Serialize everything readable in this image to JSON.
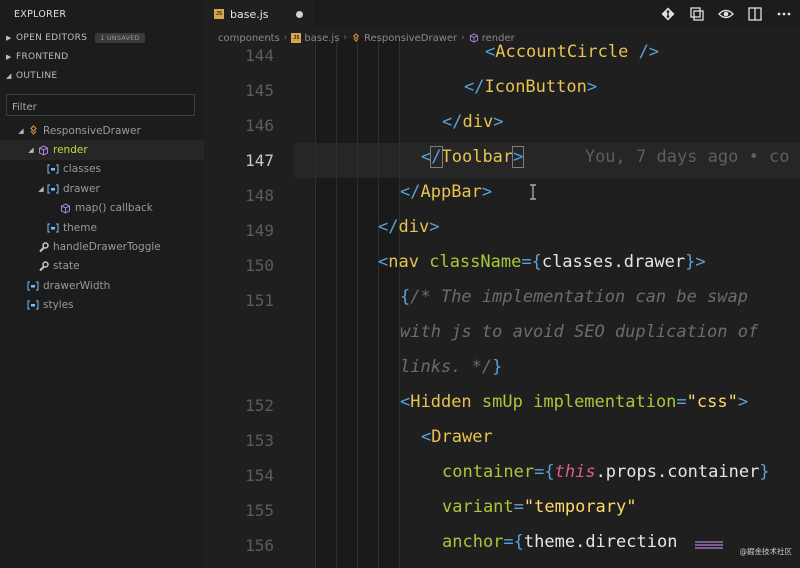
{
  "sidebar": {
    "title": "EXPLORER",
    "open_editors": {
      "label": "OPEN EDITORS",
      "badge": "1 UNSAVED"
    },
    "frontend": {
      "label": "FRONTEND"
    },
    "outline": {
      "label": "OUTLINE"
    },
    "filter": {
      "placeholder": "Filter"
    },
    "tree": [
      {
        "label": "ResponsiveDrawer",
        "icon": "component-icon",
        "depth": 2
      },
      {
        "label": "render",
        "icon": "method-cube-icon",
        "depth": 3,
        "selected": true
      },
      {
        "label": "classes",
        "icon": "variable-icon",
        "depth": 4
      },
      {
        "label": "drawer",
        "icon": "variable-icon",
        "depth": 4
      },
      {
        "label": "map() callback",
        "icon": "method-cube-icon",
        "depth": 5
      },
      {
        "label": "theme",
        "icon": "variable-icon",
        "depth": 4
      },
      {
        "label": "handleDrawerToggle",
        "icon": "wrench-icon",
        "depth": 3
      },
      {
        "label": "state",
        "icon": "wrench-icon",
        "depth": 3
      },
      {
        "label": "drawerWidth",
        "icon": "variable-icon",
        "depth": 2
      },
      {
        "label": "styles",
        "icon": "variable-icon",
        "depth": 2
      }
    ]
  },
  "tab": {
    "filename": "base.js",
    "file_badge": "JS"
  },
  "breadcrumb": {
    "folder": "components",
    "file": "base.js",
    "component": "ResponsiveDrawer",
    "method": "render"
  },
  "editor": {
    "line_numbers": [
      "144",
      "145",
      "146",
      "147",
      "148",
      "149",
      "150",
      "151",
      "",
      "",
      "152",
      "153",
      "154",
      "155",
      "156"
    ],
    "blame": "You, 7 days ago • co",
    "code": {
      "l144_tag": "AccountCircle",
      "l145_tag": "IconButton",
      "l146_tag": "div",
      "l147_tag": "Toolbar",
      "l148_tag": "AppBar",
      "l149_tag": "div",
      "l150_tag": "nav",
      "l150_attr": "className",
      "l150_expr": "classes.drawer",
      "l151_comment_1": "/* The implementation can be swap",
      "l151_comment_2": "with js to avoid SEO duplication of",
      "l151_comment_3": "links. */",
      "l152_tag": "Hidden",
      "l152_attr1": "smUp",
      "l152_attr2": "implementation",
      "l152_value": "\"css\"",
      "l153_tag": "Drawer",
      "l154_attr": "container",
      "l154_kw": "this",
      "l154_expr": ".props.container",
      "l155_attr": "variant",
      "l155_value": "\"temporary\"",
      "l156_attr": "anchor",
      "l156_expr": "theme.direction"
    }
  },
  "watermark": "@掘金技术社区",
  "colors": {
    "accent": "#c2dc3e",
    "tag": "#e7c34f",
    "punctuation": "#5aa2d8",
    "attribute": "#a8c83c"
  }
}
